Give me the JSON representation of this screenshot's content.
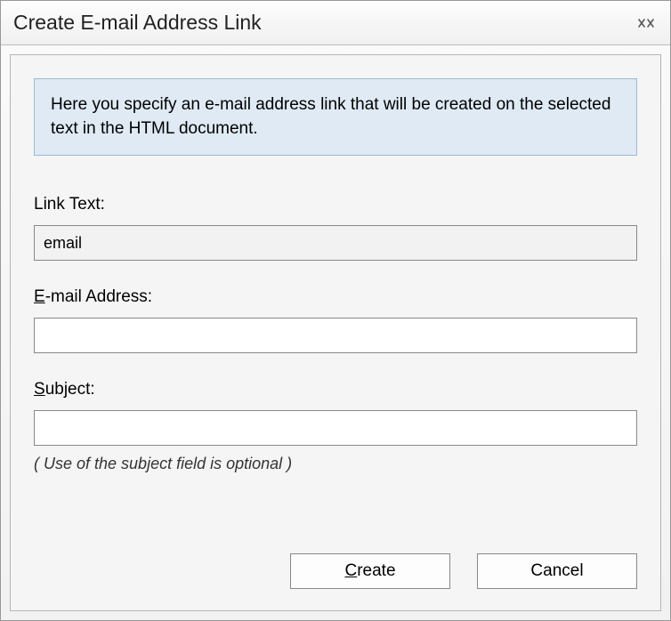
{
  "titlebar": {
    "title": "Create E-mail Address Link"
  },
  "info": {
    "text": "Here you specify an e-mail address link that will be created on the selected text in the HTML document."
  },
  "fields": {
    "linkText": {
      "label_full": "Link Text:",
      "value": "email"
    },
    "email": {
      "label_pre": "",
      "label_mnemonic": "E",
      "label_post": "-mail Address:",
      "value": ""
    },
    "subject": {
      "label_pre": "",
      "label_mnemonic": "S",
      "label_post": "ubject:",
      "value": "",
      "hint": "( Use of the subject field is optional )"
    }
  },
  "buttons": {
    "create": {
      "pre": "",
      "mnemonic": "C",
      "post": "reate"
    },
    "cancel": {
      "label": "Cancel"
    }
  }
}
